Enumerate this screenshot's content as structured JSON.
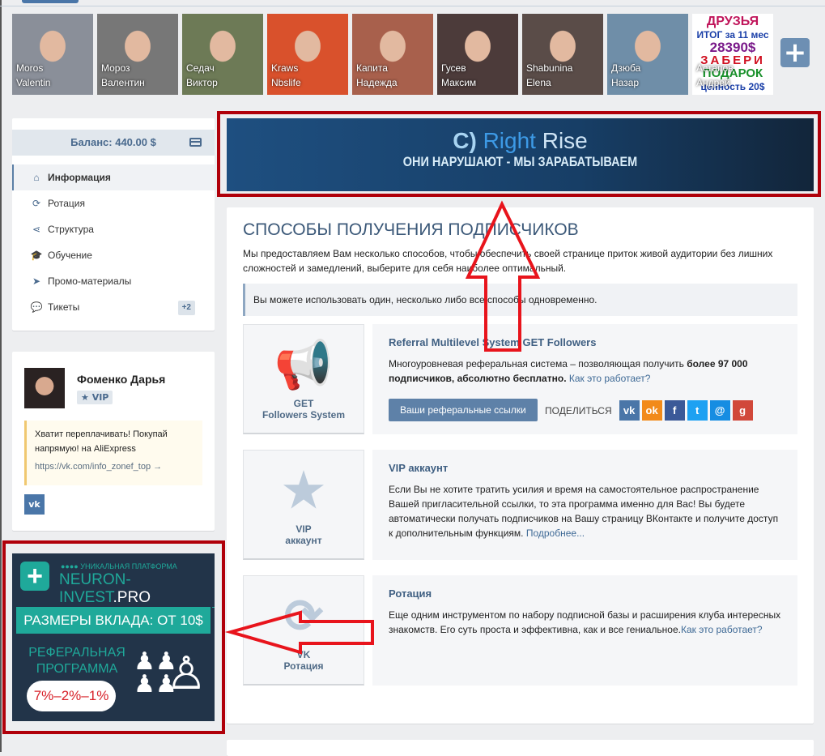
{
  "friends": [
    {
      "first": "Moros",
      "last": "Valentin",
      "color": "#8a8f99"
    },
    {
      "first": "Мороз",
      "last": "Валентин",
      "color": "#777"
    },
    {
      "first": "Седач",
      "last": "Виктор",
      "color": "#6d7a56"
    },
    {
      "first": "Kraws",
      "last": "Nbslife",
      "color": "#d9512c"
    },
    {
      "first": "Капита",
      "last": "Надежда",
      "color": "#a8604c"
    },
    {
      "first": "Гусев",
      "last": "Максим",
      "color": "#4c3b3a"
    },
    {
      "first": "Shabunina",
      "last": "Elena",
      "color": "#5a4c48"
    },
    {
      "first": "Дзюба",
      "last": "Назар",
      "color": "#6f8ea8"
    },
    {
      "first": "Астапов",
      "last": "Андрей",
      "color": "#ffffff"
    }
  ],
  "promo_tile": [
    "ДРУЗЬЯ",
    "ИТОГ за 11 мес",
    "28390$",
    "ЗАБЕРИ",
    "ПОДАРОК",
    "ценность 20$"
  ],
  "add_friend": "+",
  "sidebar": {
    "balance": "Баланс: 440.00 $",
    "items": [
      {
        "label": "Информация",
        "icon": "home-icon",
        "glyph": "⌂",
        "active": true
      },
      {
        "label": "Ротация",
        "icon": "refresh-icon",
        "glyph": "⟳"
      },
      {
        "label": "Структура",
        "icon": "share-icon",
        "glyph": "⋖"
      },
      {
        "label": "Обучение",
        "icon": "graduation-cap-icon",
        "glyph": "🎓"
      },
      {
        "label": "Промо-материалы",
        "icon": "paper-plane-icon",
        "glyph": "➤"
      },
      {
        "label": "Тикеты",
        "icon": "comments-icon",
        "glyph": "💬",
        "badge": "+2"
      }
    ]
  },
  "profile": {
    "name": "Фоменко Дарья",
    "badge": "★ VIP",
    "quote": "Хватит переплачивать! Покупай напрямую! на AliExpress",
    "link": "https://vk.com/info_zonef_top →",
    "vk": "vk"
  },
  "ad_left": {
    "tagline": "●●●● УНИКАЛЬНАЯ ПЛАТФОРМА",
    "brand": "NEURON-INVEST",
    "tld": ".PRO",
    "deposit": "РАЗМЕРЫ ВКЛАДА: ОТ 10$",
    "referral": "РЕФЕРАЛЬНАЯ ПРОГРАММА",
    "percent": "7%–2%–1%"
  },
  "ad_top": {
    "brand_a": "Right",
    "brand_b": " Rise",
    "slogan": "ОНИ НАРУШАЮТ - МЫ ЗАРАБАТЫВАЕМ"
  },
  "main": {
    "title": "СПОСОБЫ ПОЛУЧЕНИЯ ПОДПИСЧИКОВ",
    "desc": "Мы предоставляем Вам несколько способов, чтобы обеспечить своей странице приток живой аудитории без лишних сложностей и замедлений, выберите для себя наиболее оптимальный.",
    "note": "Вы можете использовать один, несколько либо все способы одновременно.",
    "methods": [
      {
        "tile1": "GET",
        "tile2": "Followers System",
        "glyph": "📢",
        "title": "Referral Multilevel System GET Followers",
        "text": "Многоуровневая реферальная система – позволяющая получить ",
        "bold": "более 97 000 подписчиков, абсолютно бесплатно.",
        "link": " Как это работает?",
        "button": "Ваши реферальные ссылки",
        "share": "ПОДЕЛИТЬСЯ"
      },
      {
        "tile1": "VIP",
        "tile2": "аккаунт",
        "glyph": "★",
        "title": "VIP аккаунт",
        "text": "Если Вы не хотите тратить усилия и время на самостоятельное распространение Вашей пригласительной ссылки, то эта программа именно для Вас! Вы будете автоматически получать подписчиков на Вашу страницу ВКонтакте и получите доступ к дополнительным функциям.",
        "link": " Подробнее..."
      },
      {
        "tile1": "VK",
        "tile2": "Ротация",
        "glyph": "⟳",
        "title": "Ротация",
        "text": "Еще одним инструментом по набору подписной базы и расширения клуба интересных знакомств. Его суть проста и эффективна, как и все гениальное.",
        "link": "Как это работает?"
      }
    ],
    "share_icons": [
      {
        "name": "vk",
        "label": "vk",
        "color": "#4a76a8"
      },
      {
        "name": "odnoklassniki",
        "label": "ok",
        "color": "#f28a1a"
      },
      {
        "name": "facebook",
        "label": "f",
        "color": "#3b5998"
      },
      {
        "name": "twitter",
        "label": "t",
        "color": "#1da1f2"
      },
      {
        "name": "mail",
        "label": "@",
        "color": "#168de2"
      },
      {
        "name": "google-plus",
        "label": "g",
        "color": "#d1483a"
      }
    ]
  },
  "colors": {
    "accent": "#4a76a8",
    "annotation": "#e8141c",
    "highlight_box": "#b0000a"
  }
}
